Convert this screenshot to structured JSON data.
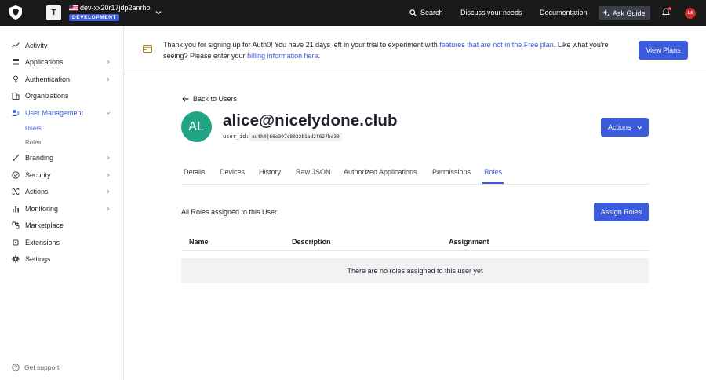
{
  "topbar": {
    "tenant_initial": "T",
    "tenant_name": "dev-xx20r17jdp2anrho",
    "env_badge": "DEVELOPMENT",
    "search_label": "Search",
    "discuss_label": "Discuss your needs",
    "docs_label": "Documentation",
    "ask_guide_label": "Ask Guide",
    "avatar_initials": "LA"
  },
  "sidebar": {
    "items": [
      {
        "label": "Activity",
        "icon": "activity-icon"
      },
      {
        "label": "Applications",
        "icon": "applications-icon"
      },
      {
        "label": "Authentication",
        "icon": "authentication-icon"
      },
      {
        "label": "Organizations",
        "icon": "organizations-icon"
      },
      {
        "label": "User Management",
        "icon": "user-management-icon"
      },
      {
        "label": "Branding",
        "icon": "brush-icon"
      },
      {
        "label": "Security",
        "icon": "shield-icon"
      },
      {
        "label": "Actions",
        "icon": "actions-icon"
      },
      {
        "label": "Monitoring",
        "icon": "chart-icon"
      },
      {
        "label": "Marketplace",
        "icon": "marketplace-icon"
      },
      {
        "label": "Extensions",
        "icon": "extensions-icon"
      },
      {
        "label": "Settings",
        "icon": "gear-icon"
      }
    ],
    "sub_items": [
      "Users",
      "Roles"
    ],
    "support_label": "Get support"
  },
  "banner": {
    "text_1": "Thank you for signing up for Auth0! You have 21 days left in your trial to experiment with ",
    "link_1": "features that are not in the Free plan",
    "text_2": ". Like what you're seeing? Please enter your ",
    "link_2": "billing information here",
    "text_3": ".",
    "button_label": "View Plans"
  },
  "main": {
    "back_label": "Back to Users",
    "avatar_initials": "AL",
    "user_name": "alice@nicelydone.club",
    "user_id_label": "user_id:",
    "user_id_value": "auth0|66e307e8022b1ad2f627be30",
    "actions_label": "Actions",
    "tabs": [
      "Details",
      "Devices",
      "History",
      "Raw JSON",
      "Authorized Applications",
      "Permissions",
      "Roles"
    ],
    "active_tab": "Roles",
    "roles_description": "All Roles assigned to this User.",
    "assign_label": "Assign Roles",
    "table": {
      "columns": [
        "Name",
        "Description",
        "Assignment"
      ],
      "empty_message": "There are no roles assigned to this user yet"
    }
  },
  "colors": {
    "accent": "#3b5bdb",
    "topbar": "#191919",
    "avatar_user": "#1fa583",
    "avatar_top": "#c9302c"
  }
}
